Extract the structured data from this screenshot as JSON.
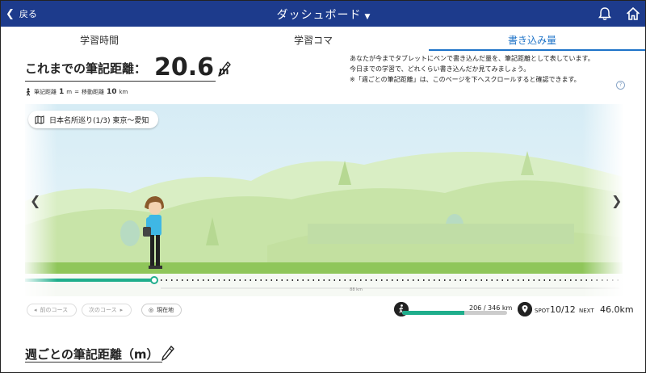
{
  "header": {
    "back_label": "戻る",
    "title": "ダッシュボード",
    "bg_color": "#1d3b8c"
  },
  "tabs": [
    {
      "label": "学習時間",
      "active": false
    },
    {
      "label": "学習コマ",
      "active": false
    },
    {
      "label": "書き込み量",
      "active": true
    }
  ],
  "distance": {
    "label": "これまでの筆記距離：",
    "value": "20.6",
    "unit": "m",
    "conversion": {
      "a_label": "筆記距離",
      "a_value": "1",
      "a_unit": "m",
      "eq": "=",
      "b_label": "移動距離",
      "b_value": "10",
      "b_unit": "km"
    }
  },
  "description": [
    "あなたが今までタブレットにペンで書き込んだ量を、筆記距離として表しています。",
    "今日までの学習で、どれくらい書き込んだか見てみましょう。",
    "※「週ごとの筆記距離」は、このページを下へスクロールすると確認できます。"
  ],
  "help_label": "?",
  "course": {
    "label": "日本名所巡り(1/3) 東京〜愛知"
  },
  "track": {
    "marker_label": "88 km"
  },
  "controls": {
    "prev_course": "前のコース",
    "next_course": "次のコース",
    "current_location": "現在地"
  },
  "progress": {
    "text": "206 / 346 km",
    "fraction": 0.595
  },
  "spot": {
    "label": "SPOT",
    "value": "10/12",
    "next_label": "NEXT",
    "next_value": "46.0km"
  },
  "weekly": {
    "title": "週ごとの筆記距離（m）"
  },
  "colors": {
    "accent": "#1e73c8",
    "progress": "#1fae8c",
    "grass": "#8fc65a"
  }
}
